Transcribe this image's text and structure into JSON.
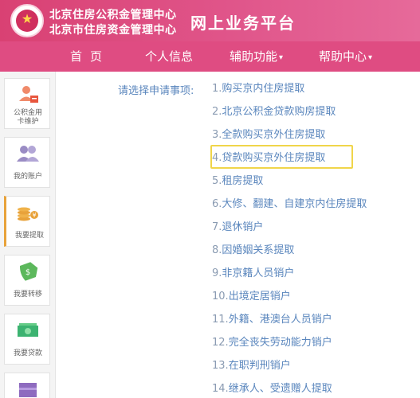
{
  "header": {
    "org_line1": "北京住房公积金管理中心",
    "org_line2": "北京市住房资金管理中心",
    "platform_title": "网上业务平台"
  },
  "nav": {
    "home": "首页",
    "personal": "个人信息",
    "aux": "辅助功能",
    "help": "帮助中心"
  },
  "sidebar": {
    "items": [
      {
        "label": "公积金用\n卡维护",
        "icon": "card-user-icon"
      },
      {
        "label": "我的账户",
        "icon": "users-icon"
      },
      {
        "label": "我要提取",
        "icon": "coins-icon",
        "active": true
      },
      {
        "label": "我要转移",
        "icon": "transfer-tag-icon"
      },
      {
        "label": "我要贷款",
        "icon": "money-icon"
      },
      {
        "label": "",
        "icon": "purple-box-icon"
      }
    ]
  },
  "main": {
    "prompt": "请选择申请事项:",
    "selected_index": 3,
    "options": [
      {
        "num": "1.",
        "text": "购买京内住房提取"
      },
      {
        "num": "2.",
        "text": "北京公积金贷款购房提取"
      },
      {
        "num": "3.",
        "text": "全款购买京外住房提取"
      },
      {
        "num": "4.",
        "text": "贷款购买京外住房提取"
      },
      {
        "num": "5.",
        "text": "租房提取"
      },
      {
        "num": "6.",
        "text": "大修、翻建、自建京内住房提取"
      },
      {
        "num": "7.",
        "text": "退休销户"
      },
      {
        "num": "8.",
        "text": "因婚姻关系提取"
      },
      {
        "num": "9.",
        "text": "非京籍人员销户"
      },
      {
        "num": "10.",
        "text": "出境定居销户"
      },
      {
        "num": "11.",
        "text": "外籍、港澳台人员销户"
      },
      {
        "num": "12.",
        "text": "完全丧失劳动能力销户"
      },
      {
        "num": "13.",
        "text": "在职判刑销户"
      },
      {
        "num": "14.",
        "text": "继承人、受遗赠人提取"
      }
    ]
  },
  "colors": {
    "header": "#d94173",
    "nav": "#df4c82",
    "link": "#5a86bd",
    "highlight": "#f0d54a"
  }
}
